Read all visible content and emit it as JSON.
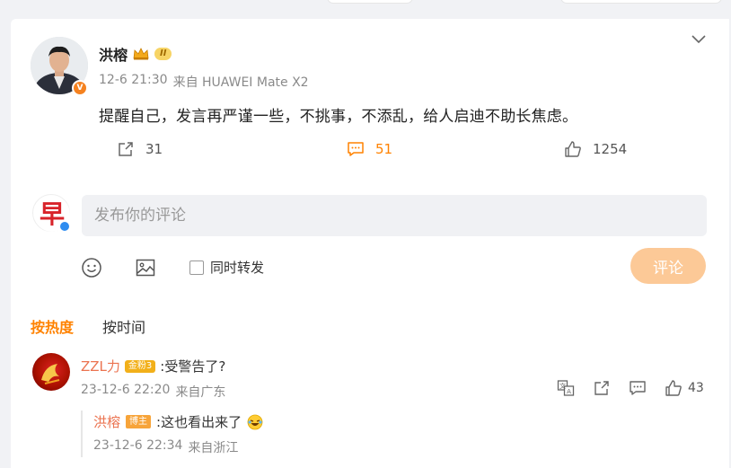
{
  "post": {
    "author": "洪榕",
    "level_badge": "II",
    "time": "12-6 21:30",
    "source": "来自 HUAWEI Mate X2",
    "text": "提醒自己，发言再严谨一些，不挑事，不添乱，给人启迪不助长焦虑。",
    "reposts": "31",
    "comments": "51",
    "likes": "1254"
  },
  "composer": {
    "placeholder": "发布你的评论",
    "repost_label": "同时转发",
    "submit_label": "评论",
    "avatar_char": "早"
  },
  "sort": {
    "hot_label": "按热度",
    "time_label": "按时间"
  },
  "comment": {
    "user": "ZZL力",
    "fan_badge": "金粉3",
    "text": ":受警告了?",
    "time": "23-12-6 22:20",
    "location": "来自广东",
    "likes": "43"
  },
  "reply": {
    "user": "洪榕",
    "op_badge": "博主",
    "text": ":这也看出来了",
    "time": "23-12-6 22:34",
    "location": "来自浙江"
  },
  "colors": {
    "accent": "#ff8200",
    "username": "#eb7350",
    "submit_disabled": "#fcc997"
  }
}
